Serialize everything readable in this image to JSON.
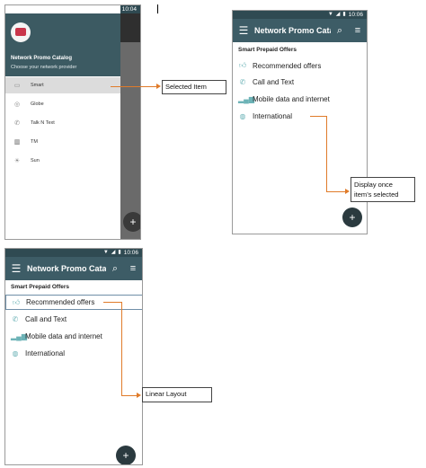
{
  "drawer_screen": {
    "status_time": "10:04",
    "app_title": "Network Promo Catalog",
    "app_subtitle": "Choose your network provider",
    "items": [
      {
        "label": "Smart",
        "icon": "smart-icon",
        "selected": true
      },
      {
        "label": "Globe",
        "icon": "globe-icon",
        "selected": false
      },
      {
        "label": "Talk N Text",
        "icon": "talk-n-text-icon",
        "selected": false
      },
      {
        "label": "TM",
        "icon": "tm-icon",
        "selected": false
      },
      {
        "label": "Sun",
        "icon": "sun-icon",
        "selected": false
      }
    ],
    "fab_label": "+"
  },
  "offers_screen_a": {
    "status_time": "10:06",
    "toolbar_title": "Network Promo Cata...",
    "section_title": "Smart Prepaid Offers",
    "items": [
      {
        "label": "Recommended offers",
        "icon": "thumbs-up-icon"
      },
      {
        "label": "Call and Text",
        "icon": "phone-message-icon"
      },
      {
        "label": "Mobile data and internet",
        "icon": "signal-bars-icon"
      },
      {
        "label": "International",
        "icon": "globe-icon"
      }
    ],
    "fab_label": "+"
  },
  "offers_screen_b": {
    "status_time": "10:06",
    "toolbar_title": "Network Promo Cata...",
    "section_title": "Smart Prepaid Offers",
    "items": [
      {
        "label": "Recommended offers",
        "icon": "thumbs-up-icon"
      },
      {
        "label": "Call and Text",
        "icon": "phone-message-icon"
      },
      {
        "label": "Mobile data and internet",
        "icon": "signal-bars-icon"
      },
      {
        "label": "International",
        "icon": "globe-icon"
      }
    ],
    "fab_label": "+"
  },
  "annotations": {
    "selected_item": "Selected Item",
    "display_once": "Display once item’s selected",
    "linear_layout": "Linear Layout"
  },
  "colors": {
    "toolbar": "#3d5c66",
    "status_bar": "#2f4a52",
    "accent_icon": "#6db3b7",
    "fab": "#2b3a3f",
    "callout_line": "#e07b2a"
  }
}
